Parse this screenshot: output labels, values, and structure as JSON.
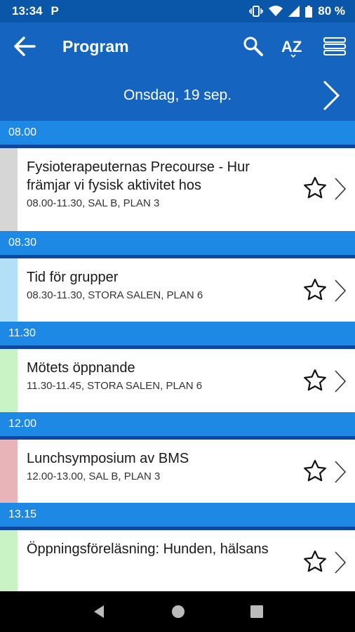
{
  "status": {
    "time": "13:34",
    "app_icon": "P",
    "battery": "80 %"
  },
  "toolbar": {
    "title": "Program",
    "sort_label": "AZ"
  },
  "datebar": {
    "date": "Onsdag, 19 sep."
  },
  "sections": [
    {
      "time": "08.00",
      "items": [
        {
          "title": "Fysioterapeuternas Precourse - Hur främjar vi fysisk aktivitet hos",
          "meta": "08.00-11.30, SAL B, PLAN 3",
          "color": "#d6d6d6"
        }
      ]
    },
    {
      "time": "08.30",
      "items": [
        {
          "title": "Tid för grupper",
          "meta": "08.30-11.30, STORA SALEN, PLAN 6",
          "color": "#b3dff7"
        }
      ]
    },
    {
      "time": "11.30",
      "items": [
        {
          "title": "Mötets öppnande",
          "meta": "11.30-11.45, STORA SALEN, PLAN 6",
          "color": "#c9f3c4"
        }
      ]
    },
    {
      "time": "12.00",
      "items": [
        {
          "title": "Lunchsymposium av BMS",
          "meta": "12.00-13.00, SAL B, PLAN 3",
          "color": "#e8b4b8"
        }
      ]
    },
    {
      "time": "13.15",
      "items": [
        {
          "title": "Öppningsföreläsning: Hunden, hälsans",
          "meta": "",
          "color": "#c9f3c4"
        }
      ]
    }
  ],
  "colors": {
    "primary": "#1565c0",
    "section": "#1e88e5",
    "section_border": "#0d47a1"
  }
}
